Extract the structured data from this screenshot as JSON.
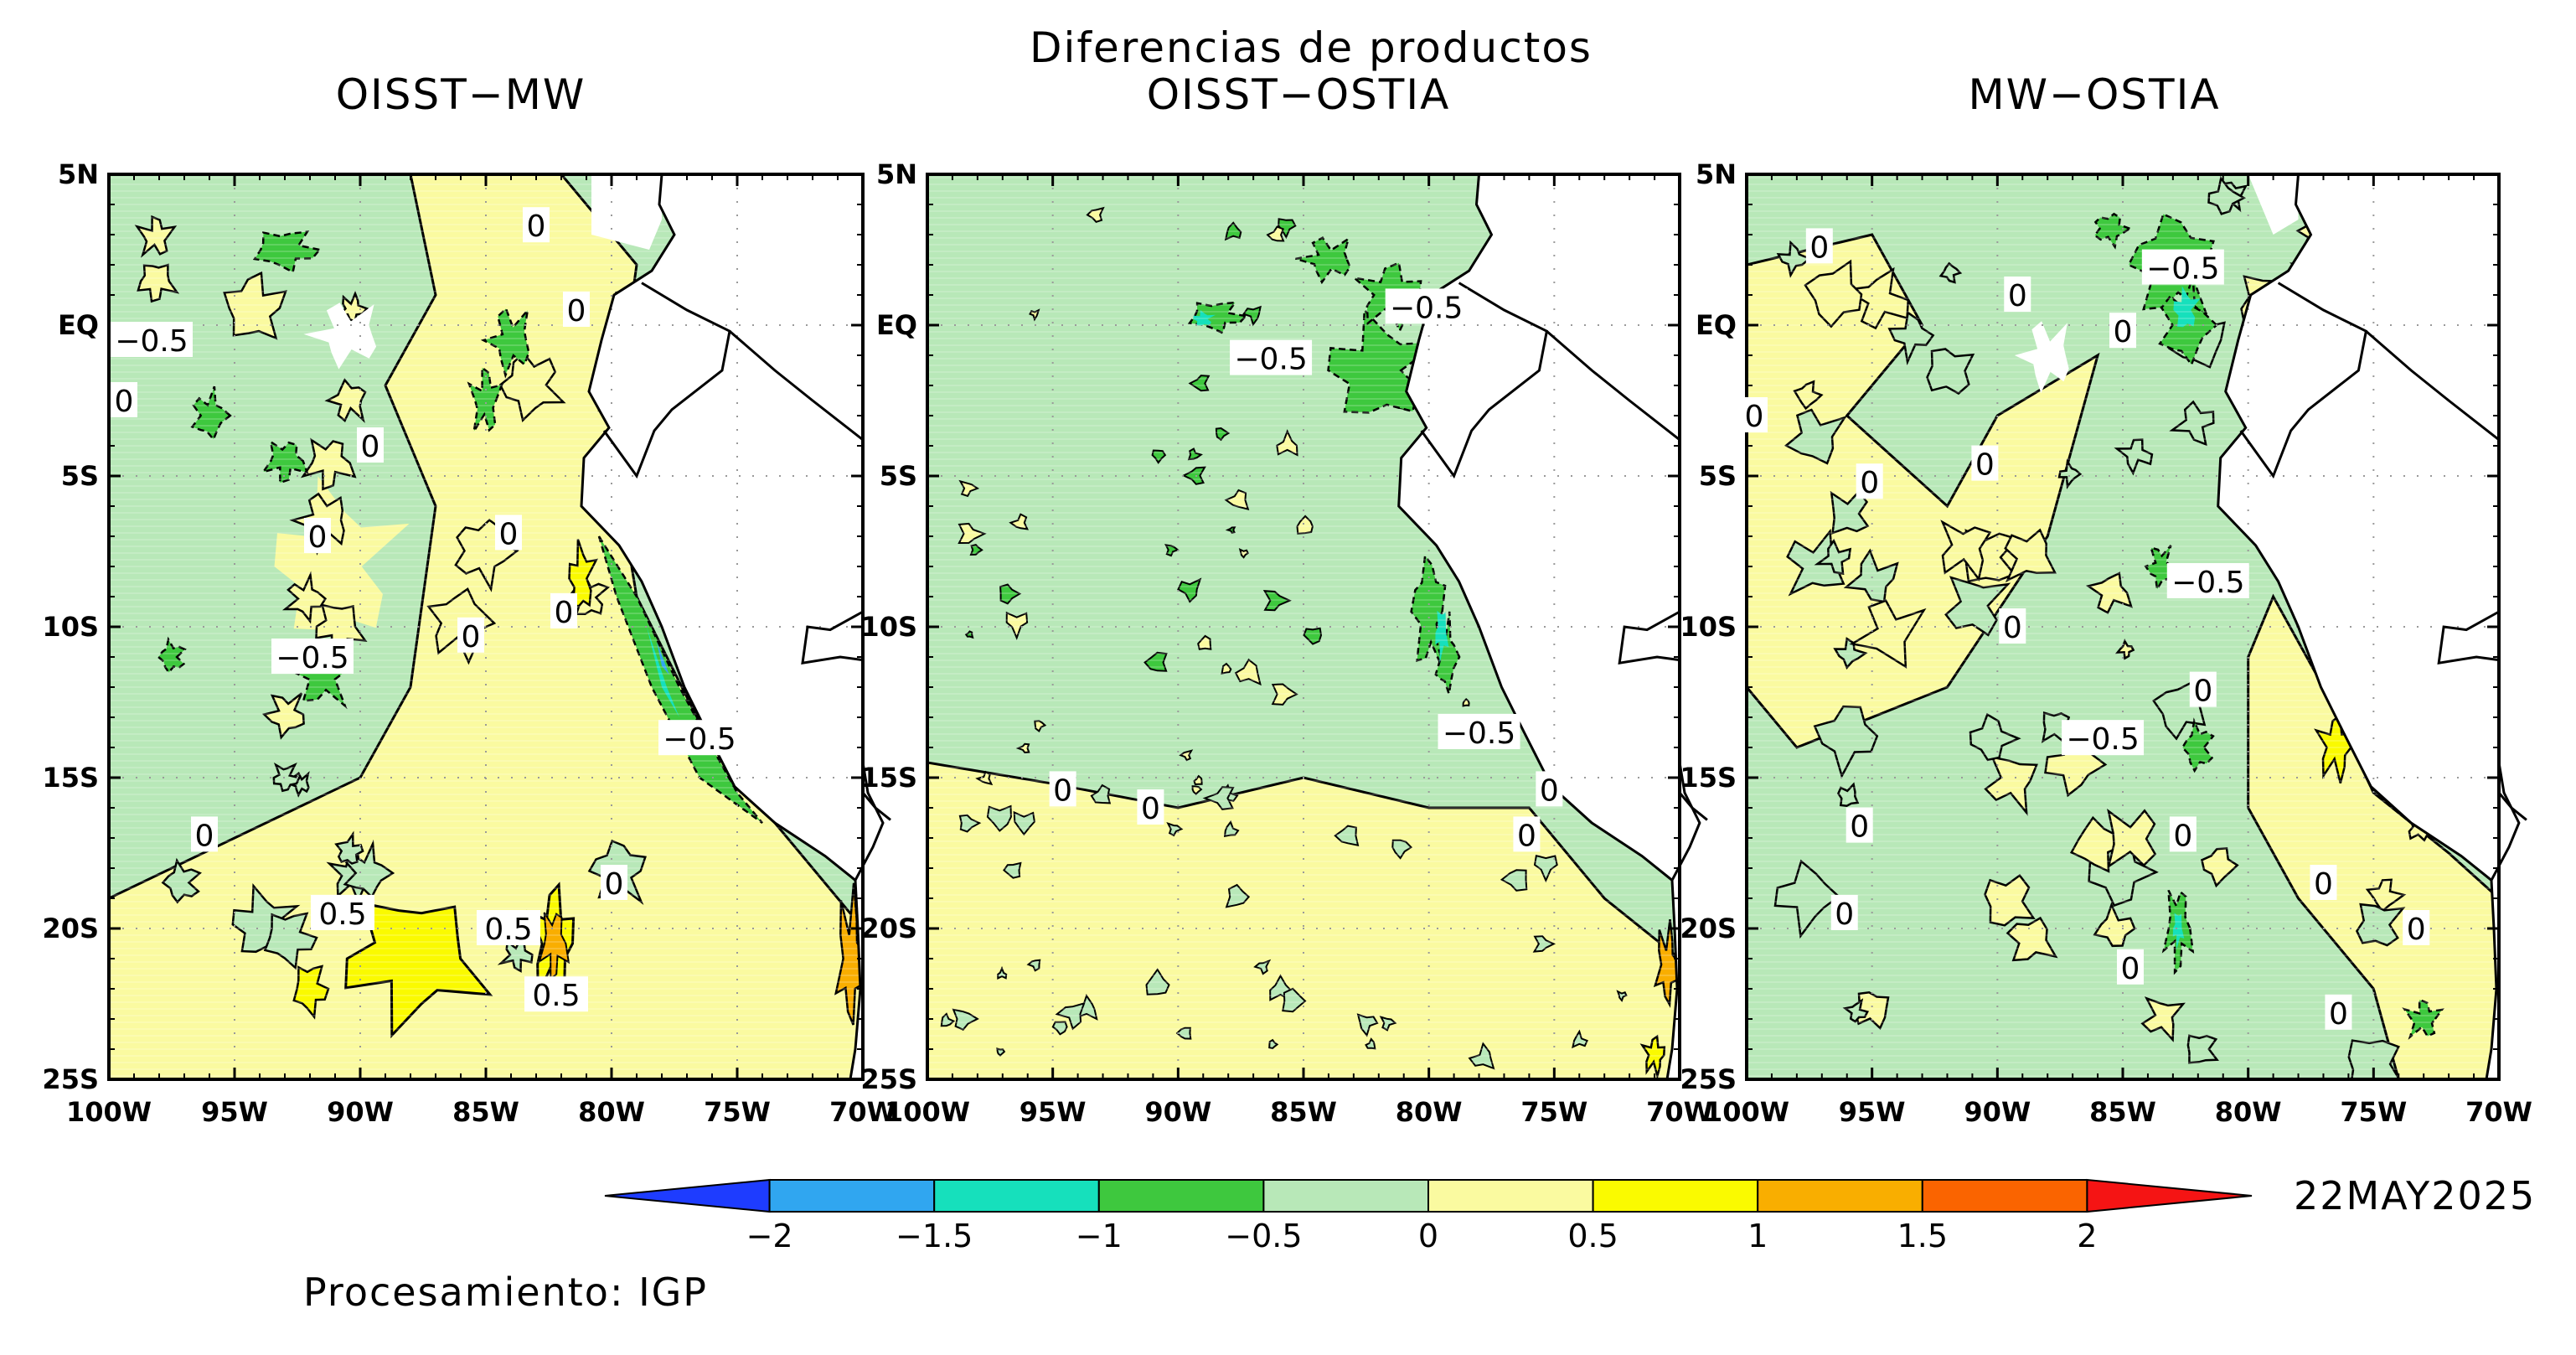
{
  "main_title": "Diferencias de productos",
  "panels": [
    {
      "title": "OISST−MW",
      "contour_labels": [
        {
          "text": "−0.5",
          "lon": -98.3,
          "lat": -0.5
        },
        {
          "text": "0",
          "lon": -99.4,
          "lat": -2.5
        },
        {
          "text": "0",
          "lon": -83.0,
          "lat": 3.3
        },
        {
          "text": "0",
          "lon": -81.4,
          "lat": 0.5
        },
        {
          "text": "0",
          "lon": -89.6,
          "lat": -4.0
        },
        {
          "text": "0",
          "lon": -91.7,
          "lat": -7.0
        },
        {
          "text": "0",
          "lon": -84.1,
          "lat": -6.9
        },
        {
          "text": "0",
          "lon": -81.9,
          "lat": -9.5
        },
        {
          "text": "0",
          "lon": -85.6,
          "lat": -10.3
        },
        {
          "text": "−0.5",
          "lon": -91.9,
          "lat": -11.0
        },
        {
          "text": "−0.5",
          "lon": -76.5,
          "lat": -13.7
        },
        {
          "text": "0",
          "lon": -96.2,
          "lat": -16.9
        },
        {
          "text": "0",
          "lon": -79.9,
          "lat": -18.5
        },
        {
          "text": "0.5",
          "lon": -90.7,
          "lat": -19.5
        },
        {
          "text": "0.5",
          "lon": -84.1,
          "lat": -20.0
        },
        {
          "text": "0.5",
          "lon": -82.2,
          "lat": -22.2
        }
      ]
    },
    {
      "title": "OISST−OSTIA",
      "contour_labels": [
        {
          "text": "−0.5",
          "lon": -80.1,
          "lat": 0.6
        },
        {
          "text": "−0.5",
          "lon": -86.3,
          "lat": -1.1
        },
        {
          "text": "−0.5",
          "lon": -78.0,
          "lat": -13.5
        },
        {
          "text": "0",
          "lon": -94.6,
          "lat": -15.4
        },
        {
          "text": "0",
          "lon": -91.1,
          "lat": -16.0
        },
        {
          "text": "0",
          "lon": -75.2,
          "lat": -15.4
        },
        {
          "text": "0",
          "lon": -76.1,
          "lat": -16.9
        }
      ]
    },
    {
      "title": "MW−OSTIA",
      "contour_labels": [
        {
          "text": "0",
          "lon": -97.1,
          "lat": 2.6
        },
        {
          "text": "−0.5",
          "lon": -82.6,
          "lat": 1.9
        },
        {
          "text": "0",
          "lon": -89.2,
          "lat": 1.0
        },
        {
          "text": "0",
          "lon": -85.0,
          "lat": -0.2
        },
        {
          "text": "0",
          "lon": -99.7,
          "lat": -3.0
        },
        {
          "text": "0",
          "lon": -95.1,
          "lat": -5.2
        },
        {
          "text": "0",
          "lon": -90.5,
          "lat": -4.6
        },
        {
          "text": "−0.5",
          "lon": -81.6,
          "lat": -8.5
        },
        {
          "text": "0",
          "lon": -89.4,
          "lat": -10.0
        },
        {
          "text": "0",
          "lon": -81.8,
          "lat": -12.1
        },
        {
          "text": "−0.5",
          "lon": -85.8,
          "lat": -13.7
        },
        {
          "text": "0",
          "lon": -95.5,
          "lat": -16.6
        },
        {
          "text": "0",
          "lon": -82.6,
          "lat": -16.9
        },
        {
          "text": "0",
          "lon": -96.1,
          "lat": -19.5
        },
        {
          "text": "0",
          "lon": -77.0,
          "lat": -18.5
        },
        {
          "text": "0",
          "lon": -73.3,
          "lat": -20.0
        },
        {
          "text": "0",
          "lon": -84.7,
          "lat": -21.3
        },
        {
          "text": "0",
          "lon": -76.4,
          "lat": -22.8
        }
      ]
    }
  ],
  "lat_ticks": [
    "5N",
    "EQ",
    "5S",
    "10S",
    "15S",
    "20S",
    "25S"
  ],
  "lon_ticks": [
    "100W",
    "95W",
    "90W",
    "85W",
    "80W",
    "75W",
    "70W"
  ],
  "map_extent": {
    "lon_min": -100,
    "lon_max": -70,
    "lat_min": -25,
    "lat_max": 5
  },
  "colorbar": {
    "labels": [
      "−2",
      "−1.5",
      "−1",
      "−0.5",
      "0",
      "0.5",
      "1",
      "1.5",
      "2"
    ],
    "colors": [
      "#1e3cff",
      "#30a6f0",
      "#16e0bc",
      "#3ec83e",
      "#b8e8b8",
      "#fafaa0",
      "#fafa00",
      "#f9ae00",
      "#fa6400",
      "#f51414"
    ]
  },
  "date_label": "22MAY2025",
  "footer": "Procesamiento: IGP"
}
